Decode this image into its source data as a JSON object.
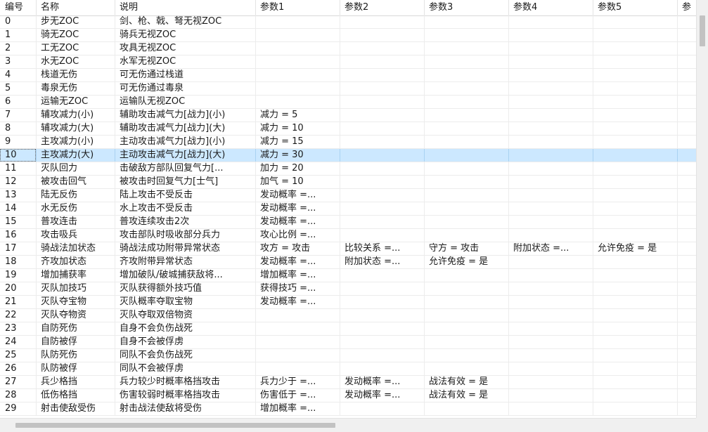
{
  "columns": [
    "编号",
    "名称",
    "说明",
    "参数1",
    "参数2",
    "参数3",
    "参数4",
    "参数5",
    "参"
  ],
  "selected_row": 10,
  "rows": [
    [
      "0",
      "步无ZOC",
      "剑、枪、戟、弩无视ZOC",
      "",
      "",
      "",
      "",
      ""
    ],
    [
      "1",
      "骑无ZOC",
      "骑兵无视ZOC",
      "",
      "",
      "",
      "",
      ""
    ],
    [
      "2",
      "工无ZOC",
      "攻具无视ZOC",
      "",
      "",
      "",
      "",
      ""
    ],
    [
      "3",
      "水无ZOC",
      "水军无视ZOC",
      "",
      "",
      "",
      "",
      ""
    ],
    [
      "4",
      "栈道无伤",
      "可无伤通过栈道",
      "",
      "",
      "",
      "",
      ""
    ],
    [
      "5",
      "毒泉无伤",
      "可无伤通过毒泉",
      "",
      "",
      "",
      "",
      ""
    ],
    [
      "6",
      "运输无ZOC",
      "运输队无视ZOC",
      "",
      "",
      "",
      "",
      ""
    ],
    [
      "7",
      "辅攻减力(小)",
      "辅助攻击减气力[战力](小)",
      "减力 = 5",
      "",
      "",
      "",
      ""
    ],
    [
      "8",
      "辅攻减力(大)",
      "辅助攻击减气力[战力](大)",
      "减力 = 10",
      "",
      "",
      "",
      ""
    ],
    [
      "9",
      "主攻减力(小)",
      "主动攻击减气力[战力](小)",
      "减力 = 15",
      "",
      "",
      "",
      ""
    ],
    [
      "10",
      "主攻减力(大)",
      "主动攻击减气力[战力](大)",
      "减力 = 30",
      "",
      "",
      "",
      ""
    ],
    [
      "11",
      "灭队回力",
      "击破敌方部队回复气力[...",
      "加力 = 20",
      "",
      "",
      "",
      ""
    ],
    [
      "12",
      "被攻击回气",
      "被攻击时回复气力[士气]",
      "加气 = 10",
      "",
      "",
      "",
      ""
    ],
    [
      "13",
      "陆无反伤",
      "陆上攻击不受反击",
      "发动概率 =...",
      "",
      "",
      "",
      ""
    ],
    [
      "14",
      "水无反伤",
      "水上攻击不受反击",
      "发动概率 =...",
      "",
      "",
      "",
      ""
    ],
    [
      "15",
      "普攻连击",
      "普攻连续攻击2次",
      "发动概率 =...",
      "",
      "",
      "",
      ""
    ],
    [
      "16",
      "攻击吸兵",
      "攻击部队时吸收部分兵力",
      "攻心比例 =...",
      "",
      "",
      "",
      ""
    ],
    [
      "17",
      "骑战法加状态",
      "骑战法成功附带异常状态",
      "攻方 = 攻击",
      "比较关系 =...",
      "守方 = 攻击",
      "附加状态 =...",
      "允许免疫 = 是"
    ],
    [
      "18",
      "齐攻加状态",
      "齐攻附带异常状态",
      "发动概率 =...",
      "附加状态 =...",
      "允许免疫 = 是",
      "",
      ""
    ],
    [
      "19",
      "增加捕获率",
      "增加破队/破城捕获敌将...",
      "增加概率 =...",
      "",
      "",
      "",
      ""
    ],
    [
      "20",
      "灭队加技巧",
      "灭队获得额外技巧值",
      "获得技巧 =...",
      "",
      "",
      "",
      ""
    ],
    [
      "21",
      "灭队夺宝物",
      "灭队概率夺取宝物",
      "发动概率 =...",
      "",
      "",
      "",
      ""
    ],
    [
      "22",
      "灭队夺物资",
      "灭队夺取双倍物资",
      "",
      "",
      "",
      "",
      ""
    ],
    [
      "23",
      "自防死伤",
      "自身不会负伤战死",
      "",
      "",
      "",
      "",
      ""
    ],
    [
      "24",
      "自防被俘",
      "自身不会被俘虏",
      "",
      "",
      "",
      "",
      ""
    ],
    [
      "25",
      "队防死伤",
      "同队不会负伤战死",
      "",
      "",
      "",
      "",
      ""
    ],
    [
      "26",
      "队防被俘",
      "同队不会被俘虏",
      "",
      "",
      "",
      "",
      ""
    ],
    [
      "27",
      "兵少格挡",
      "兵力较少时概率格挡攻击",
      "兵力少于 =...",
      "发动概率 =...",
      "战法有效 = 是",
      "",
      ""
    ],
    [
      "28",
      "低伤格挡",
      "伤害较弱时概率格挡攻击",
      "伤害低于 =...",
      "发动概率 =...",
      "战法有效 = 是",
      "",
      ""
    ],
    [
      "29",
      "射击使敌受伤",
      "射击战法使敌将受伤",
      "增加概率 =...",
      "",
      "",
      "",
      ""
    ]
  ]
}
